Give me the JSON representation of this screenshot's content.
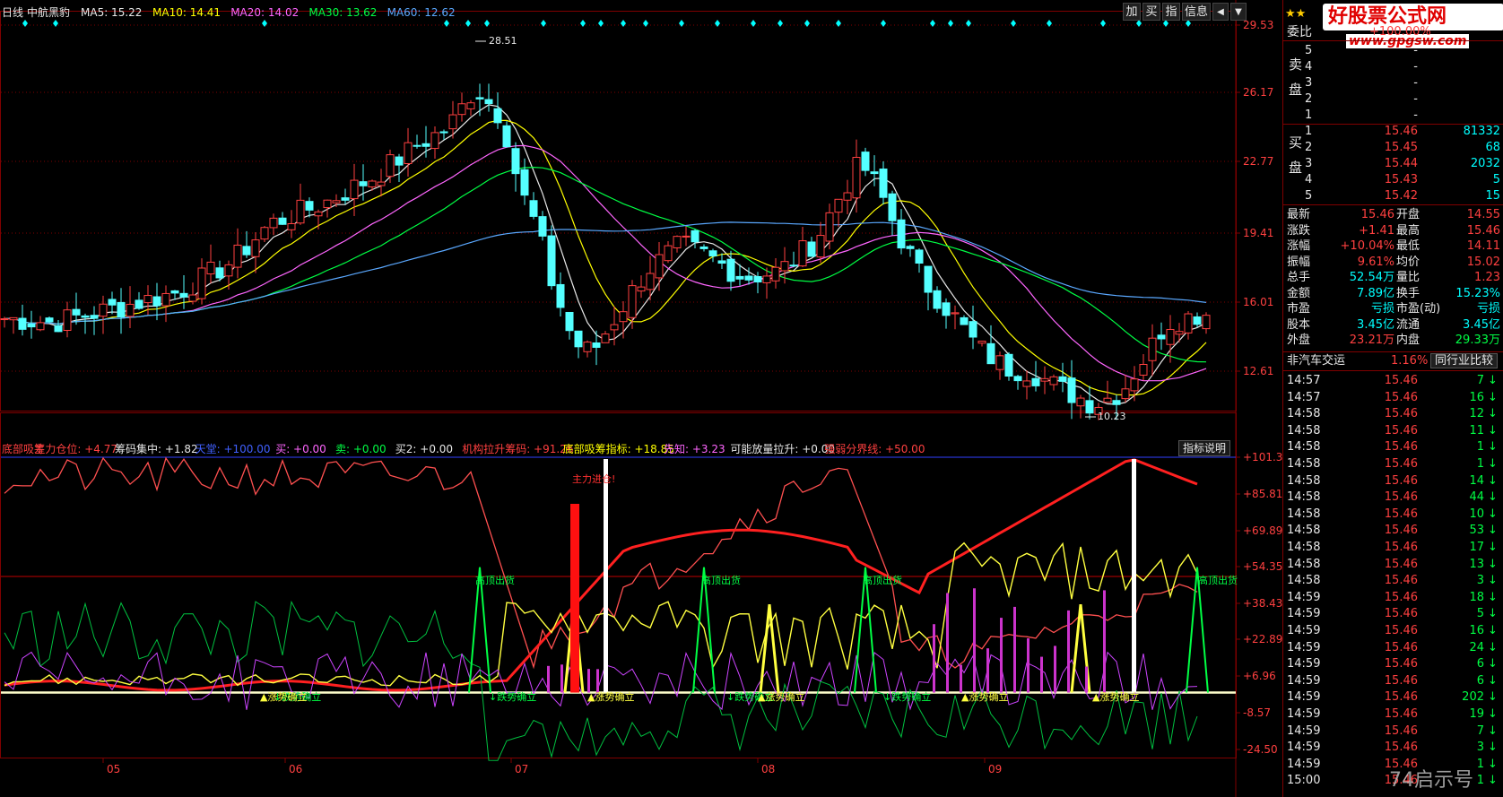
{
  "header": {
    "period": "日线",
    "stock_name": "中航黑豹",
    "ma": [
      {
        "label": "MA5: 15.22",
        "color": "#e8e8e8"
      },
      {
        "label": "MA10: 14.41",
        "color": "#ffff00"
      },
      {
        "label": "MA20: 14.02",
        "color": "#ff66ff"
      },
      {
        "label": "MA30: 13.62",
        "color": "#00ff44"
      },
      {
        "label": "MA60: 12.62",
        "color": "#5aa8ff"
      }
    ]
  },
  "main_axis": [
    "29.53",
    "26.17",
    "22.77",
    "19.41",
    "16.01",
    "12.61"
  ],
  "annotations": {
    "high": "28.51",
    "low": "10.23"
  },
  "indicator_header": [
    {
      "text": "底部吸筹",
      "color": "#ff4040"
    },
    {
      "text": "主力仓位: +4.77",
      "color": "#ff4040"
    },
    {
      "text": "筹码集中: +1.82",
      "color": "#e8e8e8"
    },
    {
      "text": "天堂: +100.00",
      "color": "#4060ff"
    },
    {
      "text": "买: +0.00",
      "color": "#ff66ff"
    },
    {
      "text": "卖: +0.00",
      "color": "#00ff44"
    },
    {
      "text": "买2: +0.00",
      "color": "#e8e8e8"
    },
    {
      "text": "机构拉升筹码: +91.26",
      "color": "#ff4040"
    },
    {
      "text": "底部吸筹指标: +18.85",
      "color": "#ffff00"
    },
    {
      "text": "先知: +3.23",
      "color": "#ff66ff"
    },
    {
      "text": "可能放量拉升: +0.00",
      "color": "#e8e8e8"
    },
    {
      "text": "强弱分界线: +50.00",
      "color": "#ff4040"
    }
  ],
  "indicator_button": "指标说明",
  "indicator_axis": [
    "101.35",
    "85.81",
    "69.89",
    "54.35",
    "38.43",
    "22.89",
    "6.96",
    "-8.57",
    "-24.50"
  ],
  "indicator_labels": {
    "top_sell": "高顶出货",
    "downtrend": "跌势确立",
    "uptrend": "涨势确立",
    "main_entry": "主力进仓!"
  },
  "x_axis": [
    "05",
    "06",
    "07",
    "08",
    "09"
  ],
  "toolbar": {
    "buttons": [
      "加",
      "买",
      "指",
      "信息"
    ],
    "arrows": [
      "◀",
      "▼"
    ]
  },
  "watermark": {
    "logo": "好股票公式网",
    "url": "www.gpgsw.com",
    "corner": "74启示号"
  },
  "order_book": {
    "title": "委比",
    "title_value": "+100.00%",
    "sell_label": "卖盘",
    "buy_label": "买盘",
    "sells": [
      {
        "level": "5",
        "price": "-",
        "vol": ""
      },
      {
        "level": "4",
        "price": "-",
        "vol": ""
      },
      {
        "level": "3",
        "price": "-",
        "vol": ""
      },
      {
        "level": "2",
        "price": "-",
        "vol": ""
      },
      {
        "level": "1",
        "price": "-",
        "vol": ""
      }
    ],
    "buys": [
      {
        "level": "1",
        "price": "15.46",
        "vol": "81332"
      },
      {
        "level": "2",
        "price": "15.45",
        "vol": "68"
      },
      {
        "level": "3",
        "price": "15.44",
        "vol": "2032"
      },
      {
        "level": "4",
        "price": "15.43",
        "vol": "5"
      },
      {
        "level": "5",
        "price": "15.42",
        "vol": "15"
      }
    ]
  },
  "quote": [
    {
      "l1": "最新",
      "v1": "15.46",
      "c1": "red",
      "l2": "开盘",
      "v2": "14.55",
      "c2": "red"
    },
    {
      "l1": "涨跌",
      "v1": "+1.41",
      "c1": "red",
      "l2": "最高",
      "v2": "15.46",
      "c2": "red"
    },
    {
      "l1": "涨幅",
      "v1": "+10.04%",
      "c1": "red",
      "l2": "最低",
      "v2": "14.11",
      "c2": "red"
    },
    {
      "l1": "振幅",
      "v1": "9.61%",
      "c1": "red",
      "l2": "均价",
      "v2": "15.02",
      "c2": "red"
    },
    {
      "l1": "总手",
      "v1": "52.54万",
      "c1": "cyan",
      "l2": "量比",
      "v2": "1.23",
      "c2": "red"
    },
    {
      "l1": "金额",
      "v1": "7.89亿",
      "c1": "cyan",
      "l2": "换手",
      "v2": "15.23%",
      "c2": "cyan"
    },
    {
      "l1": "市盈",
      "v1": "亏损",
      "c1": "cyan",
      "l2": "市盈(动)",
      "v2": "亏损",
      "c2": "cyan"
    },
    {
      "l1": "股本",
      "v1": "3.45亿",
      "c1": "cyan",
      "l2": "流通",
      "v2": "3.45亿",
      "c2": "cyan"
    },
    {
      "l1": "外盘",
      "v1": "23.21万",
      "c1": "red",
      "l2": "内盘",
      "v2": "29.33万",
      "c2": "green"
    }
  ],
  "sector": {
    "name": "非汽车交运",
    "pct": "1.16%",
    "button": "同行业比较"
  },
  "ticks": [
    {
      "time": "14:57",
      "price": "15.46",
      "vol": "7"
    },
    {
      "time": "14:57",
      "price": "15.46",
      "vol": "16"
    },
    {
      "time": "14:58",
      "price": "15.46",
      "vol": "12"
    },
    {
      "time": "14:58",
      "price": "15.46",
      "vol": "11"
    },
    {
      "time": "14:58",
      "price": "15.46",
      "vol": "1"
    },
    {
      "time": "14:58",
      "price": "15.46",
      "vol": "1"
    },
    {
      "time": "14:58",
      "price": "15.46",
      "vol": "14"
    },
    {
      "time": "14:58",
      "price": "15.46",
      "vol": "44"
    },
    {
      "time": "14:58",
      "price": "15.46",
      "vol": "10"
    },
    {
      "time": "14:58",
      "price": "15.46",
      "vol": "53"
    },
    {
      "time": "14:58",
      "price": "15.46",
      "vol": "17"
    },
    {
      "time": "14:58",
      "price": "15.46",
      "vol": "13"
    },
    {
      "time": "14:58",
      "price": "15.46",
      "vol": "3"
    },
    {
      "time": "14:59",
      "price": "15.46",
      "vol": "18"
    },
    {
      "time": "14:59",
      "price": "15.46",
      "vol": "5"
    },
    {
      "time": "14:59",
      "price": "15.46",
      "vol": "16"
    },
    {
      "time": "14:59",
      "price": "15.46",
      "vol": "24"
    },
    {
      "time": "14:59",
      "price": "15.46",
      "vol": "6"
    },
    {
      "time": "14:59",
      "price": "15.46",
      "vol": "6"
    },
    {
      "time": "14:59",
      "price": "15.46",
      "vol": "202"
    },
    {
      "time": "14:59",
      "price": "15.46",
      "vol": "19"
    },
    {
      "time": "14:59",
      "price": "15.46",
      "vol": "7"
    },
    {
      "time": "14:59",
      "price": "15.46",
      "vol": "3"
    },
    {
      "time": "14:59",
      "price": "15.46",
      "vol": "1"
    },
    {
      "time": "15:00",
      "price": "15.46",
      "vol": "1"
    }
  ],
  "colors": {
    "up": "#ff4040",
    "down": "#54ffff",
    "frame": "#800000",
    "ma5": "#e8e8e8",
    "ma10": "#ffff00",
    "ma20": "#ff66ff",
    "ma30": "#00ff44",
    "ma60": "#5aa8ff"
  }
}
